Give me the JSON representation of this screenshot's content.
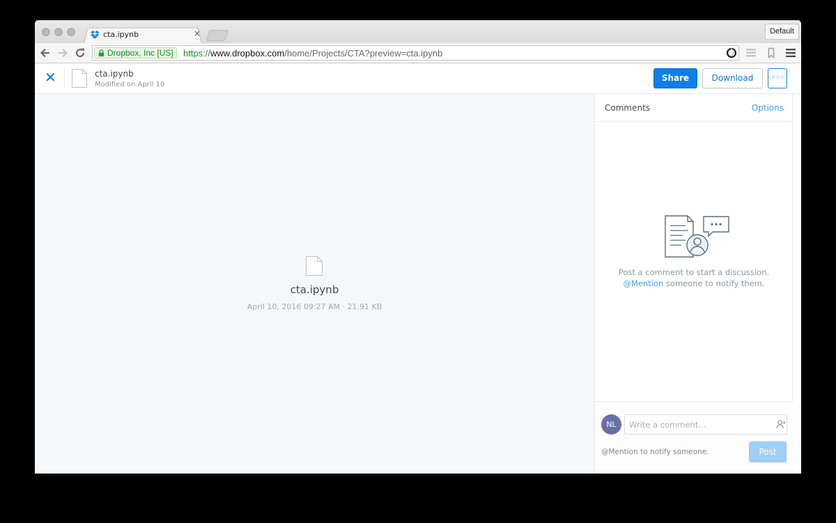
{
  "browser": {
    "tab_title": "cta.ipynb",
    "tab_close": "×",
    "profile_label": "Default",
    "ev_name": "Dropbox, Inc [US]",
    "url_scheme": "https://",
    "url_host": "www.dropbox.com",
    "url_path": "/home/Projects/CTA?preview=cta.ipynb",
    "icons": [
      "back-icon",
      "forward-icon",
      "reload-icon",
      "lock-icon",
      "star-icon",
      "extension-icon",
      "menu-icon"
    ]
  },
  "header": {
    "close_glyph": "✕",
    "file_name": "cta.ipynb",
    "modified": "Modified on April 10",
    "share_label": "Share",
    "download_label": "Download",
    "more_label": "◦◦◦"
  },
  "preview": {
    "file_name": "cta.ipynb",
    "meta": "April 10, 2016 09:27 AM · 21.91 KB"
  },
  "comments": {
    "title": "Comments",
    "options_label": "Options",
    "empty_line1": "Post a comment to start a discussion.",
    "mention_link": "@Mention",
    "empty_line2_rest": " someone to notify them.",
    "avatar_initials": "NL",
    "input_placeholder": "Write a comment...",
    "hint": "@Mention to notify someone.",
    "post_label": "Post"
  },
  "colors": {
    "accent": "#0d7fe6",
    "link": "#3d9ee0",
    "ev_green": "#1b8a2a",
    "preview_bg": "#f5f8fb",
    "avatar": "#6a6fa6",
    "post_disabled": "#9fcff5"
  }
}
